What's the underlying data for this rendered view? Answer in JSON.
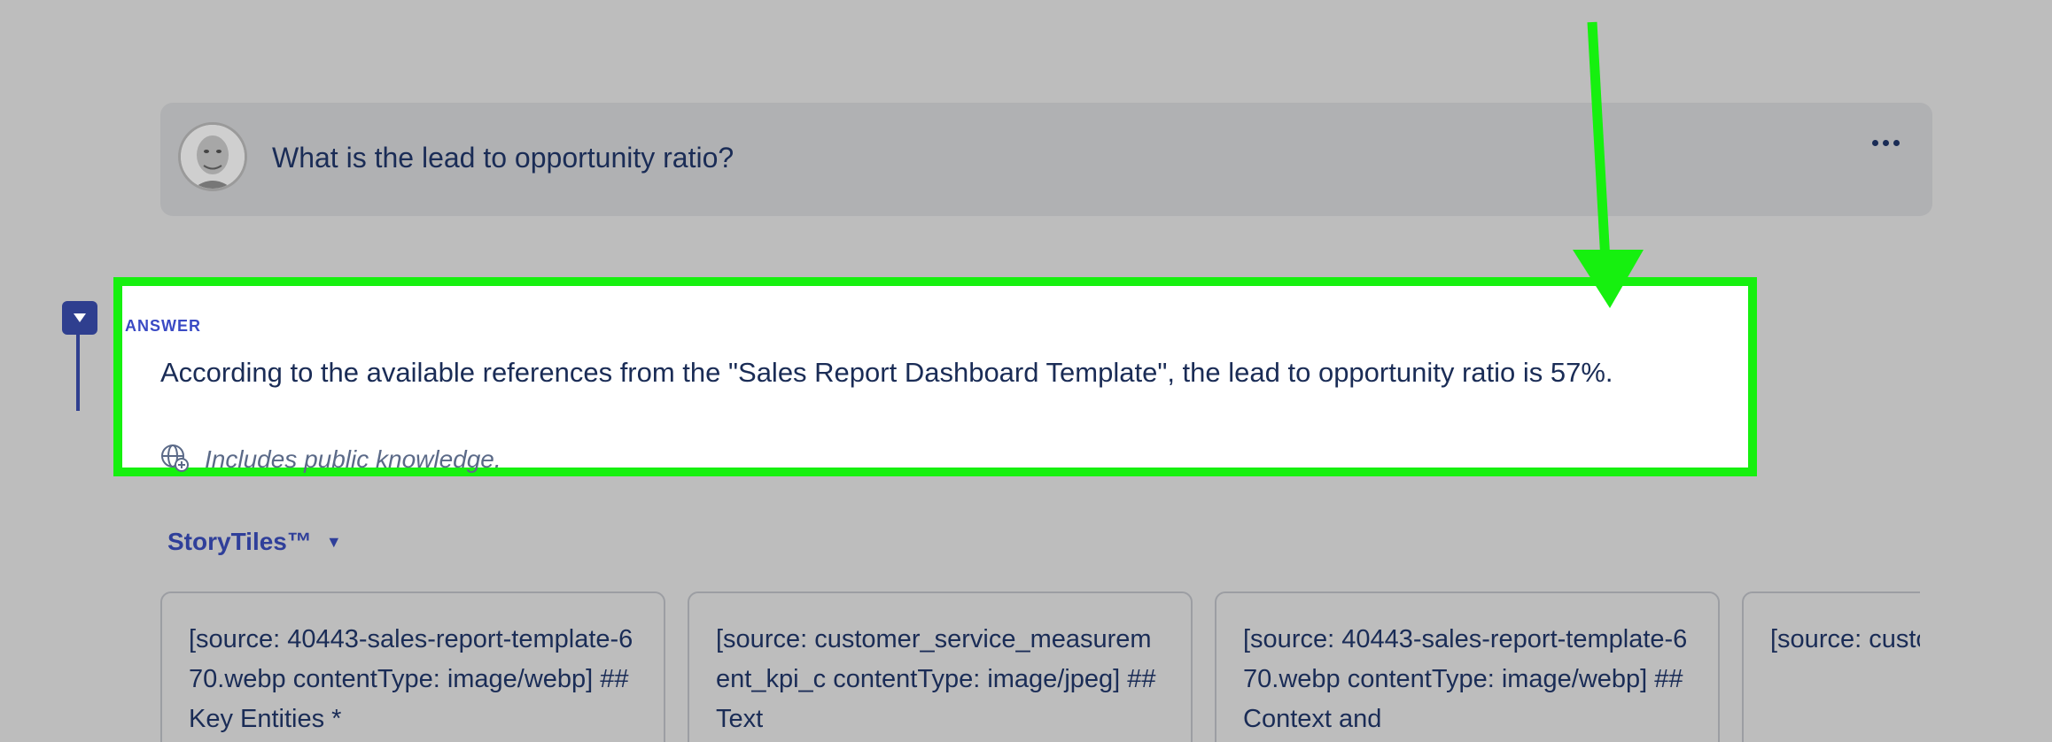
{
  "question": {
    "text": "What is the lead to opportunity ratio?"
  },
  "answer": {
    "label": "ANSWER",
    "text": "According to the available references from the \"Sales Report Dashboard Template\", the lead to opportunity ratio is 57%.",
    "note": "Includes public knowledge."
  },
  "storytiles": {
    "label": "StoryTiles™",
    "tiles": [
      {
        "text": "[source: 40443-sales-report-template-670.webp contentType: image/webp] ## Key Entities *"
      },
      {
        "text": "[source: customer_service_measurement_kpi_c contentType: image/jpeg] ## Text"
      },
      {
        "text": "[source: 40443-sales-report-template-670.webp contentType: image/webp] ## Context and"
      },
      {
        "text": "[source: customer_se contentType"
      }
    ]
  },
  "colors": {
    "highlight": "#16f00f",
    "accent": "#2f3f8f"
  },
  "icons": {
    "menu": "more-dots-icon",
    "collapse": "triangle-down-icon",
    "globe": "globe-plus-icon"
  }
}
